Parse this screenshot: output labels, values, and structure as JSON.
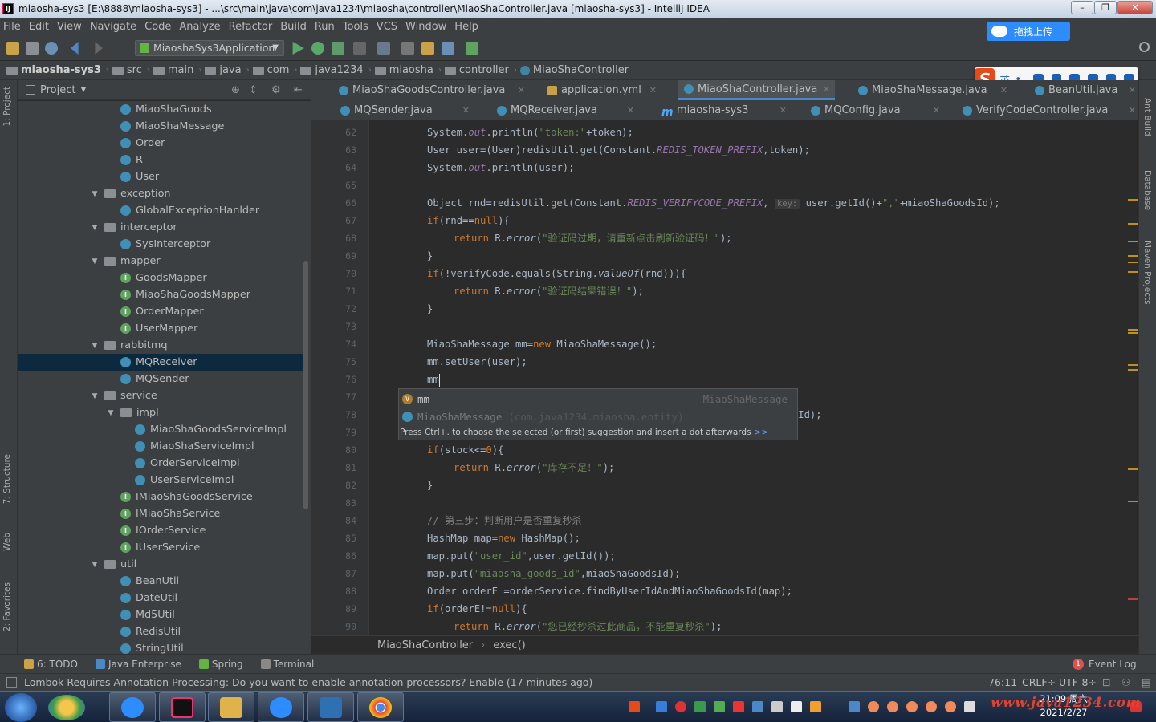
{
  "window": {
    "title": "miaosha-sys3 [E:\\8888\\miaosha-sys3] - ...\\src\\main\\java\\com\\java1234\\miaosha\\controller\\MiaoShaController.java [miaosha-sys3] - IntelliJ IDEA",
    "app_icon": "IJ"
  },
  "menu": [
    "File",
    "Edit",
    "View",
    "Navigate",
    "Code",
    "Analyze",
    "Refactor",
    "Build",
    "Run",
    "Tools",
    "VCS",
    "Window",
    "Help"
  ],
  "toolbar": {
    "run_config": "MiaoshaSys3Application",
    "upload_label": "拖拽上传"
  },
  "breadcrumb": [
    "miaosha-sys3",
    "src",
    "main",
    "java",
    "com",
    "java1234",
    "miaosha",
    "controller",
    "MiaoShaController"
  ],
  "ime": {
    "lang": "英",
    "punct": "•,"
  },
  "project_panel": {
    "title": "Project",
    "tree": [
      {
        "label": "MiaoShaGoods",
        "type": "class",
        "level": 3
      },
      {
        "label": "MiaoShaMessage",
        "type": "class",
        "level": 3
      },
      {
        "label": "Order",
        "type": "class",
        "level": 3
      },
      {
        "label": "R",
        "type": "class",
        "level": 3
      },
      {
        "label": "User",
        "type": "class",
        "level": 3
      },
      {
        "label": "exception",
        "type": "folder",
        "level": 2
      },
      {
        "label": "GlobalExceptionHanlder",
        "type": "class",
        "level": 3
      },
      {
        "label": "interceptor",
        "type": "folder",
        "level": 2
      },
      {
        "label": "SysInterceptor",
        "type": "class",
        "level": 3
      },
      {
        "label": "mapper",
        "type": "folder",
        "level": 2
      },
      {
        "label": "GoodsMapper",
        "type": "interface",
        "level": 3
      },
      {
        "label": "MiaoShaGoodsMapper",
        "type": "interface",
        "level": 3
      },
      {
        "label": "OrderMapper",
        "type": "interface",
        "level": 3
      },
      {
        "label": "UserMapper",
        "type": "interface",
        "level": 3
      },
      {
        "label": "rabbitmq",
        "type": "folder",
        "level": 2
      },
      {
        "label": "MQReceiver",
        "type": "class",
        "level": 3,
        "selected": true
      },
      {
        "label": "MQSender",
        "type": "class",
        "level": 3
      },
      {
        "label": "service",
        "type": "folder",
        "level": 2
      },
      {
        "label": "impl",
        "type": "folder",
        "level": 3
      },
      {
        "label": "MiaoShaGoodsServiceImpl",
        "type": "class",
        "level": 4
      },
      {
        "label": "MiaoShaServiceImpl",
        "type": "class",
        "level": 4
      },
      {
        "label": "OrderServiceImpl",
        "type": "class",
        "level": 4
      },
      {
        "label": "UserServiceImpl",
        "type": "class",
        "level": 4
      },
      {
        "label": "IMiaoShaGoodsService",
        "type": "interface",
        "level": 3
      },
      {
        "label": "IMiaoShaService",
        "type": "interface",
        "level": 3
      },
      {
        "label": "IOrderService",
        "type": "interface",
        "level": 3
      },
      {
        "label": "IUserService",
        "type": "interface",
        "level": 3
      },
      {
        "label": "util",
        "type": "folder",
        "level": 2
      },
      {
        "label": "BeanUtil",
        "type": "class",
        "level": 3
      },
      {
        "label": "DateUtil",
        "type": "class",
        "level": 3
      },
      {
        "label": "Md5Util",
        "type": "class",
        "level": 3
      },
      {
        "label": "RedisUtil",
        "type": "class",
        "level": 3
      },
      {
        "label": "StringUtil",
        "type": "class",
        "level": 3
      }
    ]
  },
  "left_strip": [
    "1: Project",
    "7: Structure",
    "Web",
    "2: Favorites"
  ],
  "right_strip": [
    "Ant Build",
    "Database",
    "Maven Projects"
  ],
  "tabs_row1": [
    {
      "label": "MiaoShaGoodsController.java"
    },
    {
      "label": "application.yml"
    },
    {
      "label": "MiaoShaController.java",
      "active": true
    },
    {
      "label": "MiaoShaMessage.java"
    },
    {
      "label": "BeanUtil.java"
    }
  ],
  "tabs_row2": [
    {
      "label": "MQSender.java"
    },
    {
      "label": "MQReceiver.java"
    },
    {
      "label": "miaosha-sys3"
    },
    {
      "label": "MQConfig.java"
    },
    {
      "label": "VerifyCodeController.java"
    }
  ],
  "editor": {
    "lines": [
      {
        "n": "62",
        "html": "System.<span class=\"it\">out</span>.println(<span class=\"st\">\"token:\"</span>+token);",
        "indent": 0
      },
      {
        "n": "63",
        "html": "User user=(User)redisUtil.get(Constant.<span class=\"it\">REDIS_TOKEN_PREFIX</span>,token);",
        "indent": 0
      },
      {
        "n": "64",
        "html": "System.<span class=\"it\">out</span>.println(user);",
        "indent": 0
      },
      {
        "n": "65",
        "html": "",
        "indent": 0
      },
      {
        "n": "66",
        "html": "Object rnd=redisUtil.get(Constant.<span class=\"it\">REDIS_VERIFYCODE_PREFIX</span>, <span class=\"hint\">key:</span> user.getId()+<span class=\"st\">\",\"</span>+miaoShaGoodsId);",
        "indent": 0
      },
      {
        "n": "67",
        "html": "<span class=\"kw\">if</span>(rnd==<span class=\"kw\">null</span>){",
        "indent": 0
      },
      {
        "n": "68",
        "html": "<span class=\"kw\">return</span> R.<span class=\"fn\">error</span>(<span class=\"st\">\"验证码过期，请重新点击刷新验证码！\"</span>);",
        "indent": 1
      },
      {
        "n": "69",
        "html": "}",
        "indent": 0
      },
      {
        "n": "70",
        "html": "<span class=\"kw\">if</span>(!verifyCode.equals(String.<span class=\"fn\">valueOf</span>(rnd))){",
        "indent": 0
      },
      {
        "n": "71",
        "html": "<span class=\"kw\">return</span> R.<span class=\"fn\">error</span>(<span class=\"st\">\"验证码结果错误！\"</span>);",
        "indent": 1
      },
      {
        "n": "72",
        "html": "}",
        "indent": 0
      },
      {
        "n": "73",
        "html": "",
        "indent": 0
      },
      {
        "n": "74",
        "html": "MiaoShaMessage mm=<span class=\"kw\">new</span> MiaoShaMessage();",
        "indent": 0
      },
      {
        "n": "75",
        "html": "mm.setUser(user);",
        "indent": 0
      },
      {
        "n": "76",
        "html": "mm<span class=\"cur\"></span>",
        "indent": 0
      },
      {
        "n": "77",
        "html": "",
        "indent": 0
      },
      {
        "n": "78",
        "html": "                                                  (miaoShaGoodsId);",
        "indent": 0
      },
      {
        "n": "79",
        "html": "",
        "indent": 0
      },
      {
        "n": "80",
        "html": "<span class=\"kw\">if</span>(stock&lt;=<span class=\"kw\">0</span>){",
        "indent": 0
      },
      {
        "n": "81",
        "html": "<span class=\"kw\">return</span> R.<span class=\"fn\">error</span>(<span class=\"st\">\"库存不足！\"</span>);",
        "indent": 1
      },
      {
        "n": "82",
        "html": "}",
        "indent": 0
      },
      {
        "n": "83",
        "html": "",
        "indent": 0
      },
      {
        "n": "84",
        "html": "<span class=\"cm\">// 第三步：判断用户是否重复秒杀</span>",
        "indent": 0
      },
      {
        "n": "85",
        "html": "HashMap map=<span class=\"kw\">new</span> HashMap();",
        "indent": 0
      },
      {
        "n": "86",
        "html": "map.put(<span class=\"st\">\"user_id\"</span>,user.getId());",
        "indent": 0
      },
      {
        "n": "87",
        "html": "map.put(<span class=\"st\">\"miaosha_goods_id\"</span>,miaoShaGoodsId);",
        "indent": 0
      },
      {
        "n": "88",
        "html": "Order orderE =orderService.findByUserIdAndMiaoShaGoodsId(map);",
        "indent": 0
      },
      {
        "n": "89",
        "html": "<span class=\"kw\">if</span>(orderE!=<span class=\"kw\">null</span>){",
        "indent": 0
      },
      {
        "n": "90",
        "html": "<span class=\"kw\">return</span> R.<span class=\"fn\">error</span>(<span class=\"st\">\"您已经秒杀过此商品，不能重复秒杀\"</span>);",
        "indent": 1
      }
    ]
  },
  "completion": {
    "item1_name": "mm",
    "item1_type": "MiaoShaMessage",
    "item2_name": "MiaoShaMessage",
    "item2_pkg": "(com.java1234.miaosha.entity)",
    "hint": "Press Ctrl+. to choose the selected (or first) suggestion and insert a dot afterwards",
    "hint_link": ">>"
  },
  "editor_breadcrumb": {
    "cls": "MiaoShaController",
    "method": "exec()"
  },
  "bottom_tabs": [
    "6: TODO",
    "Java Enterprise",
    "Spring",
    "Terminal"
  ],
  "event_log": {
    "count": "1",
    "label": "Event Log"
  },
  "status": {
    "message": "Lombok Requires Annotation Processing: Do you want to enable annotation processors? Enable (17 minutes ago)",
    "position": "76:11",
    "line_sep": "CRLF÷",
    "encoding": "UTF-8÷"
  },
  "taskbar": {
    "time": "21:09 周六",
    "date": "2021/2/27",
    "watermark": "www.java1234.com"
  }
}
